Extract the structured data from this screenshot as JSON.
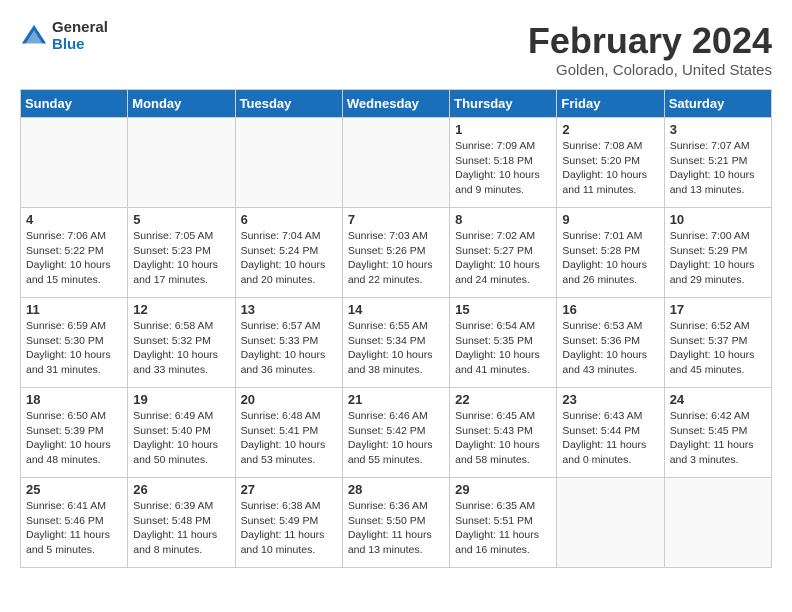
{
  "header": {
    "logo_general": "General",
    "logo_blue": "Blue",
    "month_title": "February 2024",
    "location": "Golden, Colorado, United States"
  },
  "days_of_week": [
    "Sunday",
    "Monday",
    "Tuesday",
    "Wednesday",
    "Thursday",
    "Friday",
    "Saturday"
  ],
  "weeks": [
    [
      {
        "day": "",
        "detail": ""
      },
      {
        "day": "",
        "detail": ""
      },
      {
        "day": "",
        "detail": ""
      },
      {
        "day": "",
        "detail": ""
      },
      {
        "day": "1",
        "detail": "Sunrise: 7:09 AM\nSunset: 5:18 PM\nDaylight: 10 hours\nand 9 minutes."
      },
      {
        "day": "2",
        "detail": "Sunrise: 7:08 AM\nSunset: 5:20 PM\nDaylight: 10 hours\nand 11 minutes."
      },
      {
        "day": "3",
        "detail": "Sunrise: 7:07 AM\nSunset: 5:21 PM\nDaylight: 10 hours\nand 13 minutes."
      }
    ],
    [
      {
        "day": "4",
        "detail": "Sunrise: 7:06 AM\nSunset: 5:22 PM\nDaylight: 10 hours\nand 15 minutes."
      },
      {
        "day": "5",
        "detail": "Sunrise: 7:05 AM\nSunset: 5:23 PM\nDaylight: 10 hours\nand 17 minutes."
      },
      {
        "day": "6",
        "detail": "Sunrise: 7:04 AM\nSunset: 5:24 PM\nDaylight: 10 hours\nand 20 minutes."
      },
      {
        "day": "7",
        "detail": "Sunrise: 7:03 AM\nSunset: 5:26 PM\nDaylight: 10 hours\nand 22 minutes."
      },
      {
        "day": "8",
        "detail": "Sunrise: 7:02 AM\nSunset: 5:27 PM\nDaylight: 10 hours\nand 24 minutes."
      },
      {
        "day": "9",
        "detail": "Sunrise: 7:01 AM\nSunset: 5:28 PM\nDaylight: 10 hours\nand 26 minutes."
      },
      {
        "day": "10",
        "detail": "Sunrise: 7:00 AM\nSunset: 5:29 PM\nDaylight: 10 hours\nand 29 minutes."
      }
    ],
    [
      {
        "day": "11",
        "detail": "Sunrise: 6:59 AM\nSunset: 5:30 PM\nDaylight: 10 hours\nand 31 minutes."
      },
      {
        "day": "12",
        "detail": "Sunrise: 6:58 AM\nSunset: 5:32 PM\nDaylight: 10 hours\nand 33 minutes."
      },
      {
        "day": "13",
        "detail": "Sunrise: 6:57 AM\nSunset: 5:33 PM\nDaylight: 10 hours\nand 36 minutes."
      },
      {
        "day": "14",
        "detail": "Sunrise: 6:55 AM\nSunset: 5:34 PM\nDaylight: 10 hours\nand 38 minutes."
      },
      {
        "day": "15",
        "detail": "Sunrise: 6:54 AM\nSunset: 5:35 PM\nDaylight: 10 hours\nand 41 minutes."
      },
      {
        "day": "16",
        "detail": "Sunrise: 6:53 AM\nSunset: 5:36 PM\nDaylight: 10 hours\nand 43 minutes."
      },
      {
        "day": "17",
        "detail": "Sunrise: 6:52 AM\nSunset: 5:37 PM\nDaylight: 10 hours\nand 45 minutes."
      }
    ],
    [
      {
        "day": "18",
        "detail": "Sunrise: 6:50 AM\nSunset: 5:39 PM\nDaylight: 10 hours\nand 48 minutes."
      },
      {
        "day": "19",
        "detail": "Sunrise: 6:49 AM\nSunset: 5:40 PM\nDaylight: 10 hours\nand 50 minutes."
      },
      {
        "day": "20",
        "detail": "Sunrise: 6:48 AM\nSunset: 5:41 PM\nDaylight: 10 hours\nand 53 minutes."
      },
      {
        "day": "21",
        "detail": "Sunrise: 6:46 AM\nSunset: 5:42 PM\nDaylight: 10 hours\nand 55 minutes."
      },
      {
        "day": "22",
        "detail": "Sunrise: 6:45 AM\nSunset: 5:43 PM\nDaylight: 10 hours\nand 58 minutes."
      },
      {
        "day": "23",
        "detail": "Sunrise: 6:43 AM\nSunset: 5:44 PM\nDaylight: 11 hours\nand 0 minutes."
      },
      {
        "day": "24",
        "detail": "Sunrise: 6:42 AM\nSunset: 5:45 PM\nDaylight: 11 hours\nand 3 minutes."
      }
    ],
    [
      {
        "day": "25",
        "detail": "Sunrise: 6:41 AM\nSunset: 5:46 PM\nDaylight: 11 hours\nand 5 minutes."
      },
      {
        "day": "26",
        "detail": "Sunrise: 6:39 AM\nSunset: 5:48 PM\nDaylight: 11 hours\nand 8 minutes."
      },
      {
        "day": "27",
        "detail": "Sunrise: 6:38 AM\nSunset: 5:49 PM\nDaylight: 11 hours\nand 10 minutes."
      },
      {
        "day": "28",
        "detail": "Sunrise: 6:36 AM\nSunset: 5:50 PM\nDaylight: 11 hours\nand 13 minutes."
      },
      {
        "day": "29",
        "detail": "Sunrise: 6:35 AM\nSunset: 5:51 PM\nDaylight: 11 hours\nand 16 minutes."
      },
      {
        "day": "",
        "detail": ""
      },
      {
        "day": "",
        "detail": ""
      }
    ]
  ]
}
